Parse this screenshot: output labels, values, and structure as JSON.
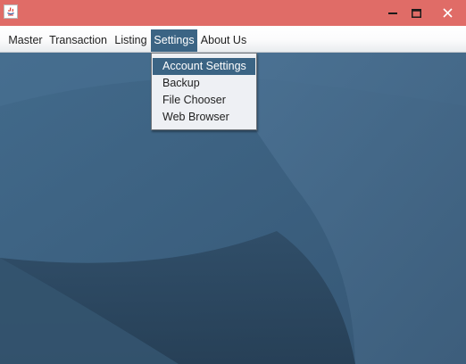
{
  "window": {
    "title": "",
    "icon": "java-cup-icon",
    "controls": {
      "minimize": "minimize-icon",
      "maximize": "maximize-icon",
      "close": "close-icon"
    }
  },
  "menubar": {
    "items": [
      {
        "label": "Master"
      },
      {
        "label": "Transaction"
      },
      {
        "label": "Listing"
      },
      {
        "label": "Settings",
        "open": true
      },
      {
        "label": "About Us"
      }
    ]
  },
  "popup": {
    "items": [
      {
        "label": "Account Settings",
        "highlighted": true
      },
      {
        "label": "Backup"
      },
      {
        "label": "File Chooser"
      },
      {
        "label": "Web Browser"
      }
    ]
  },
  "colors": {
    "titlebar": "#e06c67",
    "menu_highlight": "#3b6484",
    "desktop_base": "#3f6483",
    "popup_bg": "#eef0f4"
  }
}
